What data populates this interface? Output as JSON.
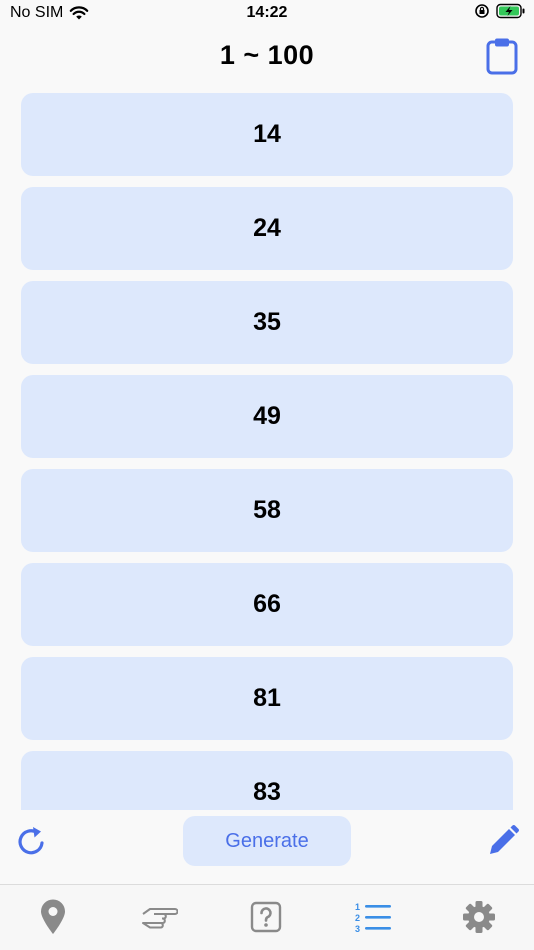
{
  "status_bar": {
    "carrier": "No SIM",
    "time": "14:22"
  },
  "nav": {
    "title": "1 ~ 100",
    "clipboard_icon": "clipboard-icon"
  },
  "results": [
    {
      "value": "14"
    },
    {
      "value": "24"
    },
    {
      "value": "35"
    },
    {
      "value": "49"
    },
    {
      "value": "58"
    },
    {
      "value": "66"
    },
    {
      "value": "81"
    },
    {
      "value": "83"
    }
  ],
  "toolbar": {
    "generate_label": "Generate",
    "refresh_icon": "refresh-icon",
    "edit_icon": "pencil-icon"
  },
  "tabs": [
    {
      "name": "location",
      "icon": "location-pin-icon",
      "active": false
    },
    {
      "name": "tap",
      "icon": "pointing-hand-icon",
      "active": false
    },
    {
      "name": "question",
      "icon": "question-box-icon",
      "active": false
    },
    {
      "name": "list",
      "icon": "numbered-list-icon",
      "active": true
    },
    {
      "name": "settings",
      "icon": "gear-icon",
      "active": false
    }
  ],
  "colors": {
    "accent": "#4a6fe8",
    "item_bg": "#dde8fc",
    "tab_active": "#3a8ee6",
    "tab_inactive": "#8a8a8a"
  }
}
